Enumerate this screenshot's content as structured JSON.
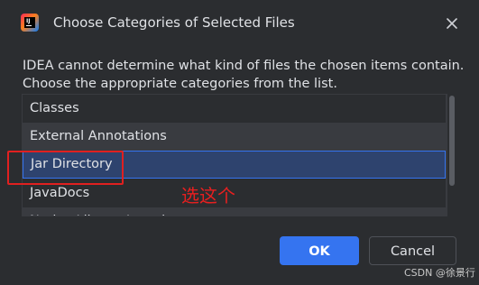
{
  "window": {
    "title": "Choose Categories of Selected Files",
    "app_icon": "intellij-idea-icon",
    "app_icon_letters": "IJ"
  },
  "message": {
    "line1": "IDEA cannot determine what kind of files the chosen items contain.",
    "line2": "Choose the appropriate categories from the list."
  },
  "list": {
    "items": [
      {
        "label": "Classes"
      },
      {
        "label": "External Annotations"
      },
      {
        "label": "Jar Directory",
        "selected": true
      },
      {
        "label": "JavaDocs"
      },
      {
        "label": "Native Library Location"
      }
    ]
  },
  "annotation": {
    "text": "选这个",
    "color": "#e81f1f"
  },
  "buttons": {
    "ok_label": "OK",
    "cancel_label": "Cancel"
  },
  "watermark": {
    "text": "CSDN @徐景行"
  },
  "colors": {
    "background": "#2b2d30",
    "accent": "#3574f0",
    "selection": "#2e436e",
    "highlight_box": "#e02020"
  }
}
